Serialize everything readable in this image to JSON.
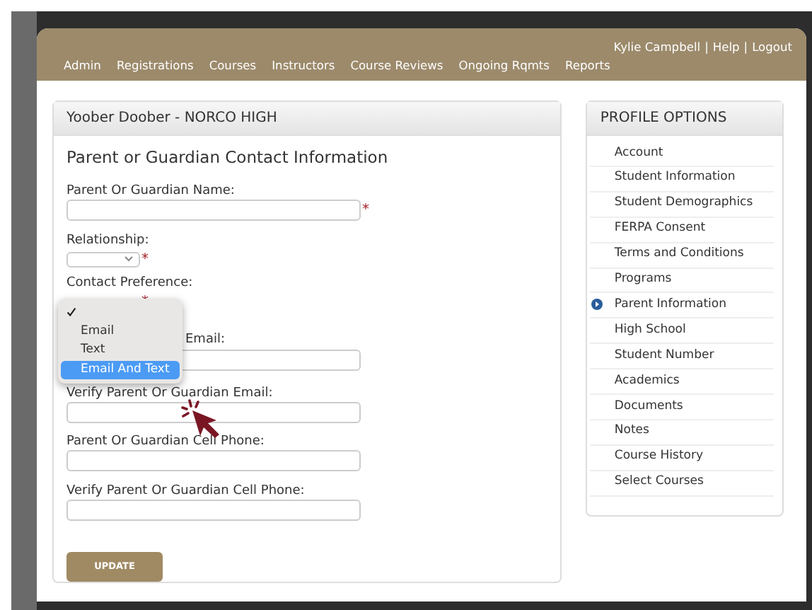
{
  "header": {
    "user_links": [
      {
        "label": "Kylie Campbell"
      },
      {
        "label": "Help"
      },
      {
        "label": "Logout"
      }
    ],
    "separator": "|",
    "nav": [
      "Admin",
      "Registrations",
      "Courses",
      "Instructors",
      "Course Reviews",
      "Ongoing Rqmts",
      "Reports"
    ]
  },
  "main_panel": {
    "title": "Yoober Doober - NORCO HIGH",
    "heading": "Parent or Guardian Contact Information",
    "required_mark": "*",
    "fields": [
      {
        "kind": "text",
        "label": "Parent Or Guardian Name:",
        "required": true
      },
      {
        "kind": "select",
        "label": "Relationship:",
        "required": true
      },
      {
        "kind": "hidden-select",
        "label": "Contact Preference:",
        "required": true
      },
      {
        "kind": "covered-text",
        "label": "Email:",
        "required": false
      },
      {
        "kind": "text",
        "label": "Verify Parent Or Guardian Email:",
        "required": false
      },
      {
        "kind": "text",
        "label": "Parent Or Guardian Cell Phone:",
        "required": false
      },
      {
        "kind": "text",
        "label": "Verify Parent Or Guardian Cell Phone:",
        "required": false
      }
    ],
    "button": "UPDATE"
  },
  "dropdown": {
    "options": [
      {
        "selected": true,
        "highlighted": false
      },
      {
        "label": "Email",
        "selected": false,
        "highlighted": false
      },
      {
        "label": "Text",
        "selected": false,
        "highlighted": false
      },
      {
        "label": "Email And Text",
        "selected": false,
        "highlighted": true
      }
    ]
  },
  "sidebar": {
    "title": "PROFILE OPTIONS",
    "items": [
      {
        "label": "Account",
        "selected": false
      },
      {
        "label": "Student Information",
        "selected": false
      },
      {
        "label": "Student Demographics",
        "selected": false
      },
      {
        "label": "FERPA Consent",
        "selected": false
      },
      {
        "label": "Terms and Conditions",
        "selected": false
      },
      {
        "label": "Programs",
        "selected": false
      },
      {
        "label": "Parent Information",
        "selected": true
      },
      {
        "label": "High School",
        "selected": false
      },
      {
        "label": "Student Number",
        "selected": false
      },
      {
        "label": "Academics",
        "selected": false
      },
      {
        "label": "Documents",
        "selected": false
      },
      {
        "label": "Notes",
        "selected": false
      },
      {
        "label": "Course History",
        "selected": false
      },
      {
        "label": "Select Courses",
        "selected": false
      }
    ]
  }
}
